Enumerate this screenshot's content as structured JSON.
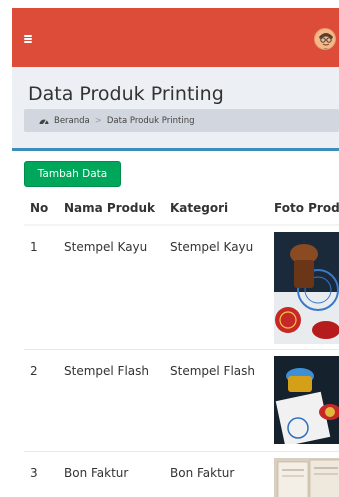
{
  "header": {
    "menu_icon": "hamburger-icon",
    "avatar_icon": "user-avatar-icon",
    "brand_color": "#dd4b39"
  },
  "content_header": {
    "title": "Data Produk Printing",
    "breadcrumb": {
      "home_icon": "dashboard-icon",
      "home": "Beranda",
      "separator": ">",
      "current": "Data Produk Printing"
    }
  },
  "box": {
    "border_color": "#3c8dbc",
    "add_button": {
      "label": "Tambah Data",
      "color": "#00a65a"
    }
  },
  "table": {
    "headers": [
      "No",
      "Nama Produk",
      "Kategori",
      "Foto Prod"
    ],
    "rows": [
      {
        "no": "1",
        "name": "Stempel Kayu",
        "category": "Stempel Kayu",
        "photo": "stamp-wood-photo"
      },
      {
        "no": "2",
        "name": "Stempel Flash",
        "category": "Stempel Flash",
        "photo": "stamp-flash-photo"
      },
      {
        "no": "3",
        "name": "Bon Faktur",
        "category": "Bon Faktur",
        "photo": "invoice-photo"
      }
    ]
  }
}
